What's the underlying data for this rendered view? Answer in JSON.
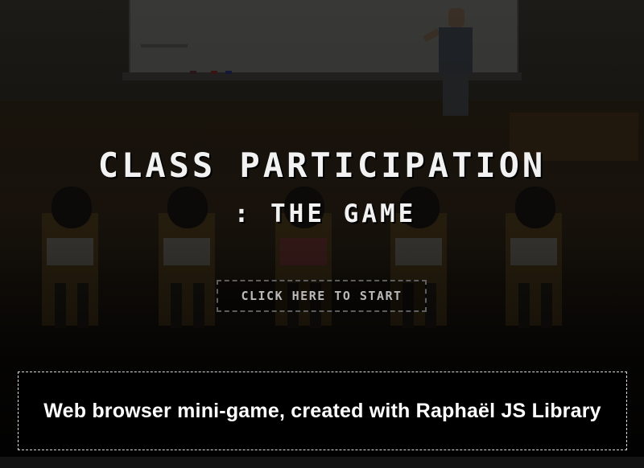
{
  "game": {
    "title_line1": "CLASS PARTICIPATION",
    "title_line2": ": THE GAME",
    "start_button_label": "CLICK HERE TO START"
  },
  "caption": {
    "text": "Web browser mini-game, created with Raphaël JS Library"
  },
  "colors": {
    "title_text": "#f2f2f2",
    "button_text": "#b9b9b9",
    "button_border": "#5e5e5e",
    "caption_text": "#ffffff",
    "caption_border": "#d8d8d8",
    "background": "#0c0a08"
  }
}
